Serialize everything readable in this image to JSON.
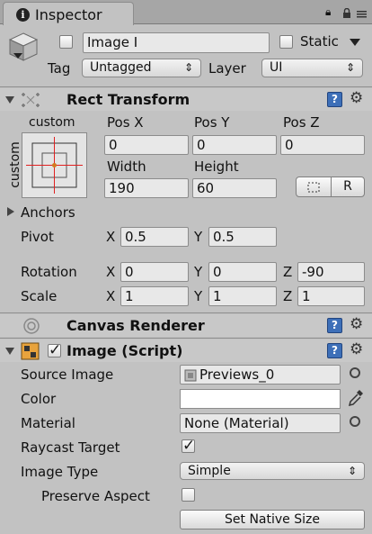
{
  "window": {
    "tab_title": "Inspector",
    "lock_icon": "lock-icon",
    "menu_icon": "menu-icon"
  },
  "header": {
    "name_value": "Image I",
    "static_label": "Static",
    "tag_label": "Tag",
    "tag_value": "Untagged",
    "layer_label": "Layer",
    "layer_value": "UI"
  },
  "rect_transform": {
    "title": "Rect Transform",
    "anchor_h": "custom",
    "anchor_v": "custom",
    "pos_x_label": "Pos X",
    "pos_y_label": "Pos Y",
    "pos_z_label": "Pos Z",
    "pos_x": "0",
    "pos_y": "0",
    "pos_z": "0",
    "width_label": "Width",
    "height_label": "Height",
    "width": "190",
    "height": "60",
    "raw_button": "R",
    "anchors_label": "Anchors",
    "pivot_label": "Pivot",
    "pivot_x": "0.5",
    "pivot_y": "0.5",
    "rotation_label": "Rotation",
    "rot_x": "0",
    "rot_y": "0",
    "rot_z": "-90",
    "scale_label": "Scale",
    "scale_x": "1",
    "scale_y": "1",
    "scale_z": "1",
    "x": "X",
    "y": "Y",
    "z": "Z"
  },
  "canvas_renderer": {
    "title": "Canvas Renderer"
  },
  "image_script": {
    "title": "Image (Script)",
    "source_image_label": "Source Image",
    "source_image_value": "Previews_0",
    "color_label": "Color",
    "material_label": "Material",
    "material_value": "None (Material)",
    "raycast_label": "Raycast Target",
    "image_type_label": "Image Type",
    "image_type_value": "Simple",
    "preserve_label": "Preserve Aspect",
    "set_native_button": "Set Native Size"
  }
}
